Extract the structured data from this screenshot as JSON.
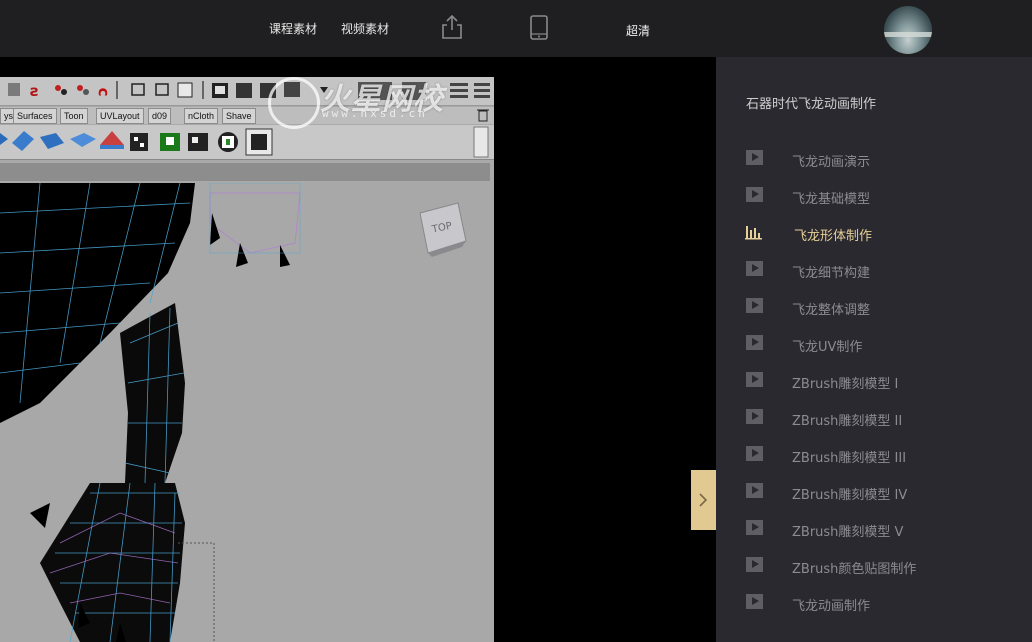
{
  "header": {
    "course_materials": "课程素材",
    "video_materials": "视频素材",
    "share_icon": "share-icon",
    "mobile_icon": "phone-icon",
    "quality": "超清"
  },
  "video": {
    "watermark_text": "火星网校",
    "watermark_url": "www.hxsd.cn",
    "maya_tabs": [
      "ys",
      "Surfaces",
      "Toon",
      "UVLayout",
      "d09",
      "nCloth",
      "Shave"
    ],
    "viewcube_label": "TOP"
  },
  "playlist": {
    "title": "石器时代飞龙动画制作",
    "active_index": 2,
    "items": [
      "飞龙动画演示",
      "飞龙基础模型",
      "飞龙形体制作",
      "飞龙细节构建",
      "飞龙整体调整",
      "飞龙UV制作",
      "ZBrush雕刻模型 I",
      "ZBrush雕刻模型 II",
      "ZBrush雕刻模型 III",
      "ZBrush雕刻模型 IV",
      "ZBrush雕刻模型 V",
      "ZBrush颜色贴图制作",
      "飞龙动画制作"
    ]
  },
  "colors": {
    "topbar": "#1f1f21",
    "sidebar": "#2a2930",
    "active": "#e7cf98",
    "toggle": "#e2c891"
  }
}
